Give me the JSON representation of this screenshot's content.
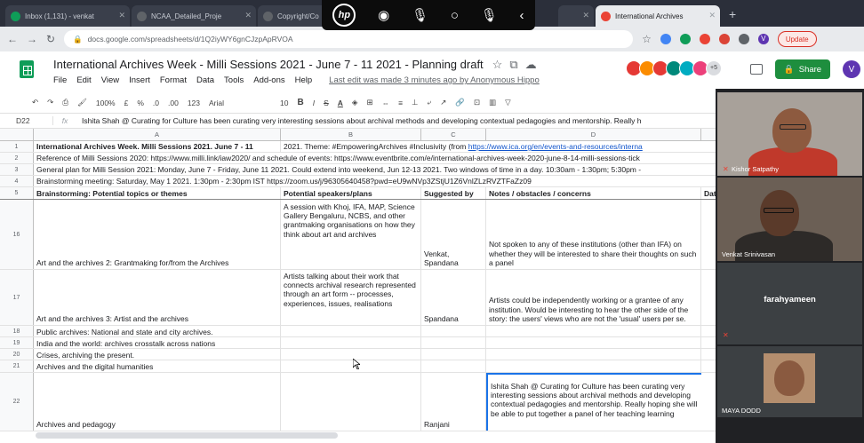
{
  "browser": {
    "tabs": [
      {
        "label": "Inbox (1,131) - venkat",
        "color": "#0f9d58"
      },
      {
        "label": "NCAA_Detailed_Proje",
        "color": "#5f6368"
      },
      {
        "label": "Copyright/Co",
        "color": "#5f6368"
      },
      {
        "label": "",
        "color": "#5f6368"
      },
      {
        "label": "International Archives",
        "color": "#ea4335"
      }
    ],
    "new_tab_glyph": "+",
    "url": "docs.google.com/spreadsheets/d/1Q2iyWY6gnCJzpApRVOA",
    "update_label": "Update",
    "profile_letter": "V"
  },
  "screen_share_bar": {
    "icons": [
      "hp-logo-icon",
      "record-icon",
      "mic-icon",
      "circle-icon",
      "mic-icon",
      "back-chevron-icon"
    ]
  },
  "doc": {
    "title": "International Archives Week - Milli Sessions 2021 - June 7 - 11 2021 - Planning draft",
    "menus": [
      "File",
      "Edit",
      "View",
      "Insert",
      "Format",
      "Data",
      "Tools",
      "Add-ons",
      "Help"
    ],
    "last_edit": "Last edit was made 3 minutes ago by Anonymous Hippo",
    "share_label": "Share",
    "user_initial": "V",
    "extra_viewers": "+5"
  },
  "toolbar": {
    "zoom": "100%",
    "currency": "£",
    "percent": "%",
    "dec_less": ".0",
    "dec_more": ".00",
    "format_more": "123",
    "font": "Arial",
    "font_size": "10",
    "bold": "B",
    "italic": "I",
    "strike": "S",
    "text_color": "A"
  },
  "formula_bar": {
    "cell_ref": "D22",
    "fx": "fx",
    "content": "Ishita Shah @ Curating for Culture has been curating very interesting sessions about archival methods and developing contextual pedagogies and mentorship. Really h"
  },
  "columns": [
    "A",
    "B",
    "C",
    "D"
  ],
  "rows": [
    {
      "num": "1",
      "a": "International Archives Week. Milli Sessions 2021. June 7 - 11",
      "b_spill": "2021. Theme: #EmpoweringArchives #Inclusivity (from ",
      "b_link": "https://www.ica.org/en/events-and-resources/interna"
    },
    {
      "num": "2",
      "spill": "Reference of Milli Sessions 2020: https://www.milli.link/iaw2020/ and schedule of events: https://www.eventbrite.com/e/international-archives-week-2020-june-8-14-milli-sessions-tick"
    },
    {
      "num": "3",
      "spill": "General plan for Milli Session 2021: Monday, June 7 - Friday, June 11 2021. Could extend into weekend, Jun 12-13 2021. Two windows of time in a day. 10:30am - 1:30pm; 5:30pm -"
    },
    {
      "num": "4",
      "spill": "Brainstorming meeting: Saturday, May 1 2021. 1:30pm - 2:30pm IST https://zoom.us/j/96305640458?pwd=eU9wNVp3ZStjU1Z6VnlZLzRVZTFaZz09"
    },
    {
      "num": "5",
      "a": "Brainstorming: Potential topics or themes",
      "b": "Potential speakers/plans",
      "c": "Suggested by",
      "d": "Notes / obstacles / concerns",
      "e": "Dat"
    },
    {
      "num": "16",
      "a": "Art and the archives 2: Grantmaking for/from the Archives",
      "b": "A session with Khoj, IFA, MAP, Science Gallery Bengaluru, NCBS, and other grantmaking organisations on how they think about art and archives",
      "c": "Venkat, Spandana",
      "d": "Not spoken to any of these institutions (other than IFA) on whether they will be interested to share their thoughts on such a panel"
    },
    {
      "num": "17",
      "a": "Art and the archives 3: Artist and the archives",
      "b": "Artists talking about their work that connects archival research represented through an art form -- processes, experiences, issues, realisations",
      "c": "Spandana",
      "d": "Artists could be independently working or a grantee of any institution. Would be interesting to hear the other side of the story: the users' views who are not the 'usual' users per se."
    },
    {
      "num": "18",
      "a": "Public archives: National and state and city archives."
    },
    {
      "num": "19",
      "a": "India and the world: archives crosstalk across nations"
    },
    {
      "num": "20",
      "a": "Crises, archiving the present."
    },
    {
      "num": "21",
      "a": "Archives and the digital humanities"
    },
    {
      "num": "22",
      "a": "Archives and pedagogy",
      "c": "Ranjani",
      "d": "Ishita Shah @ Curating for Culture has been curating very interesting sessions about archival methods and developing contextual pedagogies and mentorship. Really hoping she will be able to put together a panel of her teaching learning"
    }
  ],
  "participants": [
    {
      "name": "Kishor Satpathy",
      "kind": "video",
      "muted": true
    },
    {
      "name": "Venkat Srinivasan",
      "kind": "video",
      "muted": false
    },
    {
      "name": "farahyameen",
      "kind": "name",
      "muted": true
    },
    {
      "name": "MAYA DODD",
      "kind": "video",
      "muted": false
    }
  ]
}
